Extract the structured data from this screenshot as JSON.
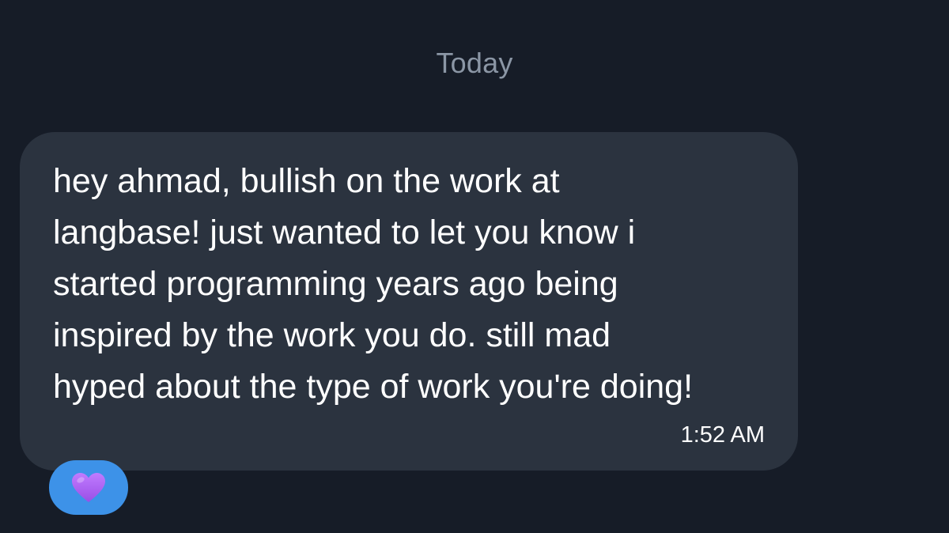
{
  "conversation": {
    "date_separator": "Today"
  },
  "message": {
    "text": "hey ahmad, bullish on the work at\nlangbase! just wanted to let you know i\nstarted programming years ago being\ninspired by the work you do. still mad\nhyped about the type of work you're doing!",
    "time": "1:52 AM",
    "bubble_color": "#2b333f"
  },
  "reaction": {
    "icon": "purple-heart-icon",
    "color": "#3d92e8",
    "heart_color": "#a55cf0"
  },
  "colors": {
    "background": "#161c27",
    "muted_text": "#8b96a5",
    "message_text": "#ffffff"
  }
}
